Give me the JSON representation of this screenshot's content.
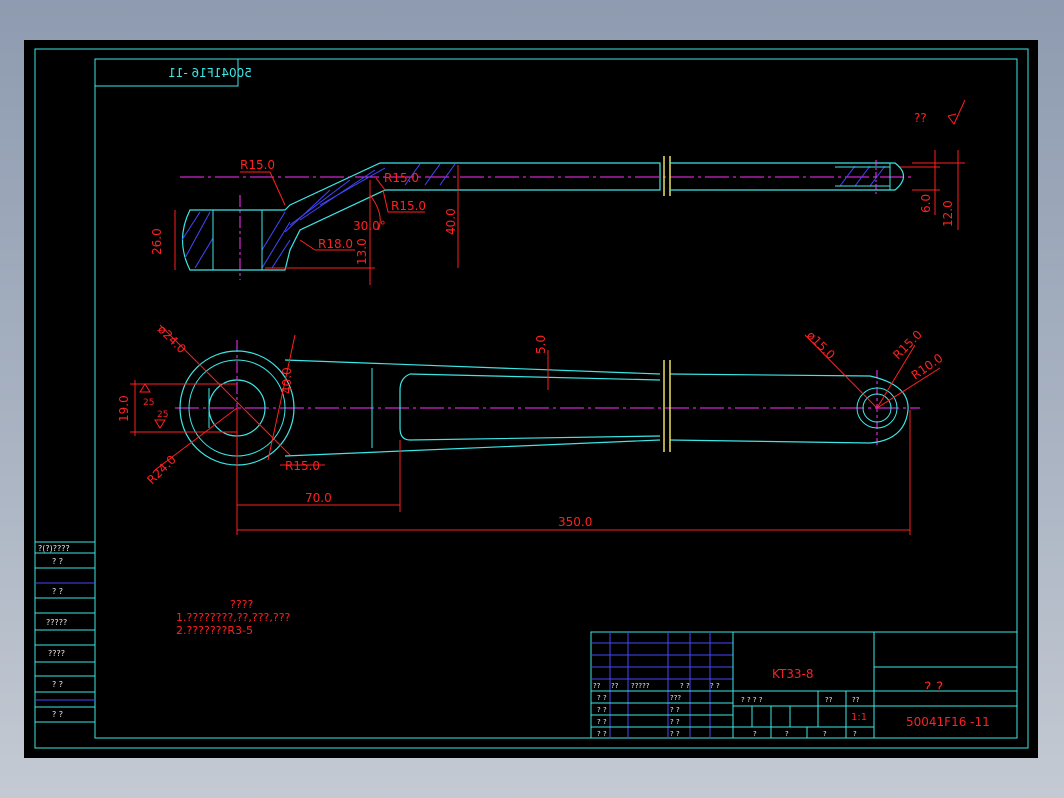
{
  "drawing": {
    "title_box_mirrored": "50041F16 -11",
    "roughness_mark": "??",
    "dims": {
      "top_R15_a": "R15.0",
      "top_R15_b": "R15.0",
      "top_R15_c": "R15.0",
      "top_R18": "R18.0",
      "top_angle": "30.0°",
      "top_13": "13.0",
      "top_26": "26.0",
      "top_40": "40.0",
      "top_6": "6.0",
      "top_12": "12.0",
      "d24": "ø24.0",
      "d15": "ø15.0",
      "R15_right": "R15.0",
      "R10_right": "R10.0",
      "dim_5": "5.0",
      "dim_40_front": "40.0",
      "dim_19": "19.0",
      "dim_25a": "25",
      "dim_25b": "25",
      "R24": "R24.0",
      "R15_front": "R15.0",
      "dim_70": "70.0",
      "dim_350": "350.0"
    },
    "notes": {
      "heading": "????",
      "line1": "1.????????,??,???,???",
      "line2": "2.???????R3-5"
    }
  },
  "left_strip": {
    "header": "?(?)????",
    "rows": [
      "?  ?",
      "?  ?",
      "?????",
      "????",
      "?  ?",
      "?  ?"
    ]
  },
  "title_block": {
    "part_code": "KT33-8",
    "material": "?  ?",
    "drawing_no": "50041F16 -11",
    "scale": "1:1",
    "header_labels": [
      "??",
      "??",
      "?????",
      "?  ?",
      "?  ?"
    ],
    "row_labels_a": [
      "?  ?",
      "?  ?",
      "?  ?",
      "?  ?"
    ],
    "row_labels_b": [
      "???",
      "?  ?",
      "?  ?",
      "?  ?"
    ],
    "mid_header": [
      "?  ?  ?  ?",
      "??",
      "??"
    ],
    "bottom_row": [
      "?",
      "?",
      "?",
      "?"
    ]
  }
}
